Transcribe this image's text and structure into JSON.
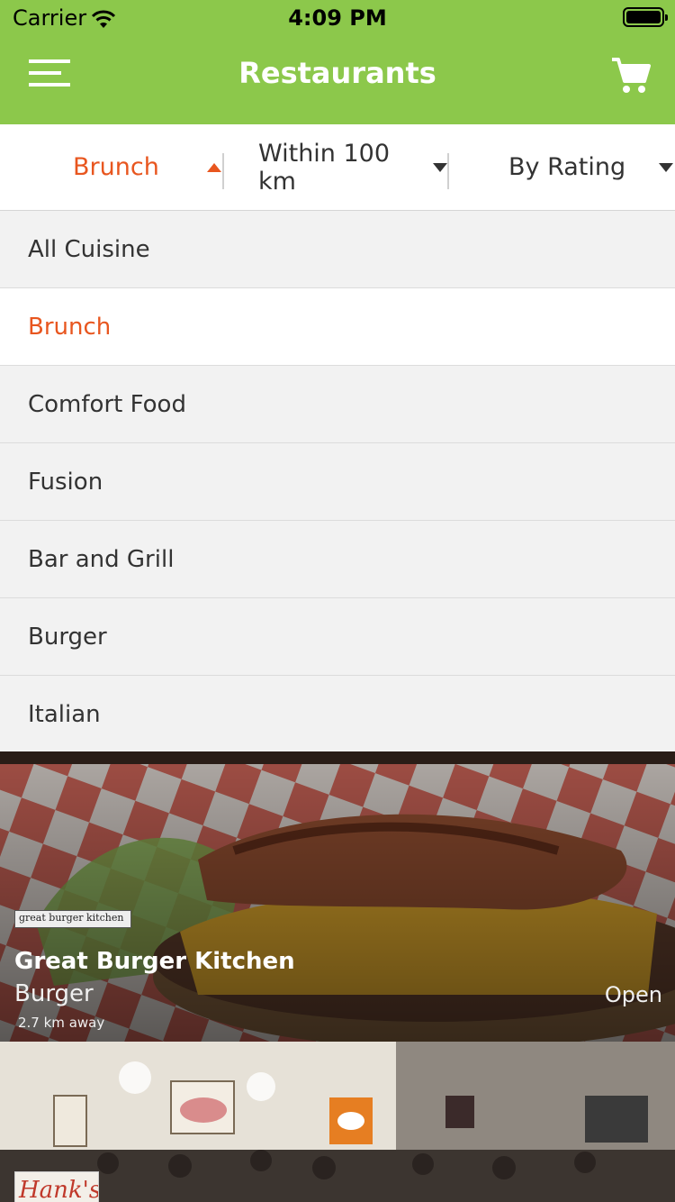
{
  "status_bar": {
    "carrier": "Carrier",
    "time": "4:09 PM"
  },
  "nav": {
    "title": "Restaurants",
    "menu_icon": "hamburger-menu-icon",
    "cart_icon": "shopping-cart-icon"
  },
  "filters": {
    "cuisine": "Brunch",
    "distance": "Within 100 km",
    "sort": "By Rating"
  },
  "cuisine_options": [
    {
      "label": "All Cuisine",
      "selected": false
    },
    {
      "label": "Brunch",
      "selected": true
    },
    {
      "label": "Comfort Food",
      "selected": false
    },
    {
      "label": "Fusion",
      "selected": false
    },
    {
      "label": "Bar and Grill",
      "selected": false
    },
    {
      "label": "Burger",
      "selected": false
    },
    {
      "label": "Italian",
      "selected": false
    }
  ],
  "restaurants": [
    {
      "logo_text": "great burger kitchen",
      "name": "Great Burger Kitchen",
      "cuisine": "Burger",
      "distance": "2.7 km away",
      "status": "Open"
    },
    {
      "logo_text": "Hank's"
    }
  ],
  "colors": {
    "brand_green": "#8cc84b",
    "accent_orange": "#e8561f",
    "dropdown_bg": "#f2f2f2"
  }
}
